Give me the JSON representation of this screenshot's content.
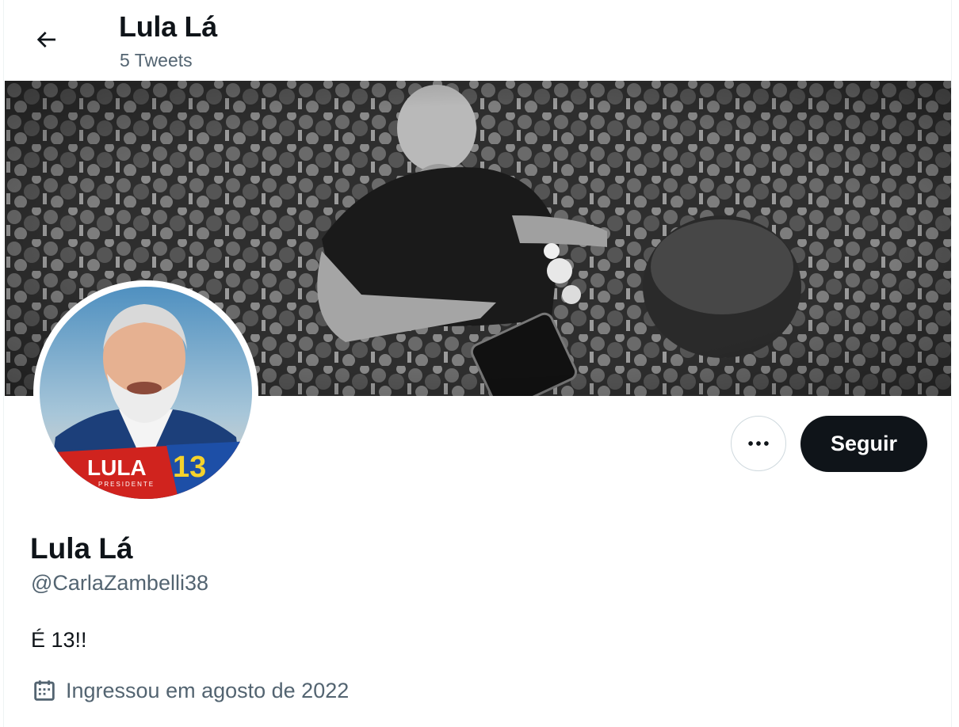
{
  "header": {
    "back_icon": "arrow-left-icon",
    "title": "Lula Lá",
    "tweet_count": "5 Tweets"
  },
  "banner": {
    "description_icon": "crowd-photo"
  },
  "avatar": {
    "badge_text": "LULA",
    "badge_number": "13",
    "badge_subtext": "PRESIDENTE"
  },
  "actions": {
    "more_icon": "more-horizontal-icon",
    "follow_label": "Seguir"
  },
  "profile": {
    "name": "Lula Lá",
    "handle": "@CarlaZambelli38",
    "bio": "É 13!!",
    "joined_icon": "calendar-icon",
    "joined": "Ingressou em agosto de 2022"
  },
  "colors": {
    "text_primary": "#0f1419",
    "text_secondary": "#536471",
    "button_dark": "#0f1419",
    "border": "#cfd9de"
  }
}
